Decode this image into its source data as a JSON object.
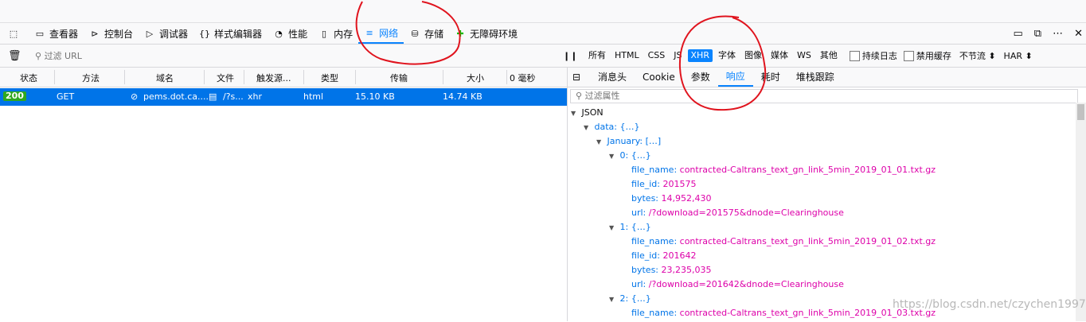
{
  "toolbar": {
    "tabs": [
      {
        "label": "查看器"
      },
      {
        "label": "控制台"
      },
      {
        "label": "调试器"
      },
      {
        "label": "样式编辑器"
      },
      {
        "label": "性能"
      },
      {
        "label": "内存"
      },
      {
        "label": "网络"
      },
      {
        "label": "存储"
      },
      {
        "label": "无障碍环境"
      }
    ]
  },
  "filter": {
    "url_placeholder": "过滤 URL",
    "types": [
      "所有",
      "HTML",
      "CSS",
      "JS",
      "XHR",
      "字体",
      "图像",
      "媒体",
      "WS",
      "其他"
    ],
    "active_type": "XHR",
    "persist_log": "持续日志",
    "disable_cache": "禁用缓存",
    "throttle": "不节流",
    "har": "HAR"
  },
  "request_list": {
    "columns": [
      "状态",
      "方法",
      "域名",
      "文件",
      "触发源...",
      "类型",
      "传输",
      "大小",
      "0 毫秒"
    ],
    "rows": [
      {
        "status": "200",
        "method": "GET",
        "domain": "pems.dot.ca....",
        "file": "/?s...",
        "cause": "xhr",
        "type": "html",
        "transferred": "15.10 KB",
        "size": "14.74 KB"
      }
    ]
  },
  "details": {
    "tabs": [
      "消息头",
      "Cookie",
      "参数",
      "响应",
      "耗时",
      "堆栈跟踪"
    ],
    "active_tab": "响应",
    "filter_placeholder": "过滤属性",
    "json_label": "JSON",
    "tree": {
      "data_key": "data:",
      "data_val": "{…}",
      "january_key": "January:",
      "january_val": "[…]",
      "items": [
        {
          "index": "0:",
          "brace": "{…}",
          "file_name": "contracted-Caltrans_text_gn_link_5min_2019_01_01.txt.gz",
          "file_id": "201575",
          "bytes": "14,952,430",
          "url": "/?download=201575&dnode=Clearinghouse"
        },
        {
          "index": "1:",
          "brace": "{…}",
          "file_name": "contracted-Caltrans_text_gn_link_5min_2019_01_02.txt.gz",
          "file_id": "201642",
          "bytes": "23,235,035",
          "url": "/?download=201642&dnode=Clearinghouse"
        },
        {
          "index": "2:",
          "brace": "{…}",
          "file_name": "contracted-Caltrans_text_gn_link_5min_2019_01_03.txt.gz"
        }
      ],
      "labels": {
        "file_name": "file_name:",
        "file_id": "file_id:",
        "bytes": "bytes:",
        "url": "url:"
      }
    }
  },
  "watermark": "https://blog.csdn.net/czychen1997",
  "icons": {
    "inspector": "inspector-icon",
    "console": "console-icon",
    "debugger": "debugger-icon",
    "style": "style-editor-icon",
    "performance": "performance-icon",
    "memory": "memory-icon",
    "network": "network-icon",
    "storage": "storage-icon",
    "accessibility": "accessibility-icon",
    "trash": "trash-icon",
    "filter": "filter-icon"
  },
  "colors": {
    "accent": "#0a84ff",
    "selected_row": "#0074e8",
    "json_key": "#0074e8",
    "json_string": "#dd00a9",
    "annotation": "#e0141e"
  }
}
